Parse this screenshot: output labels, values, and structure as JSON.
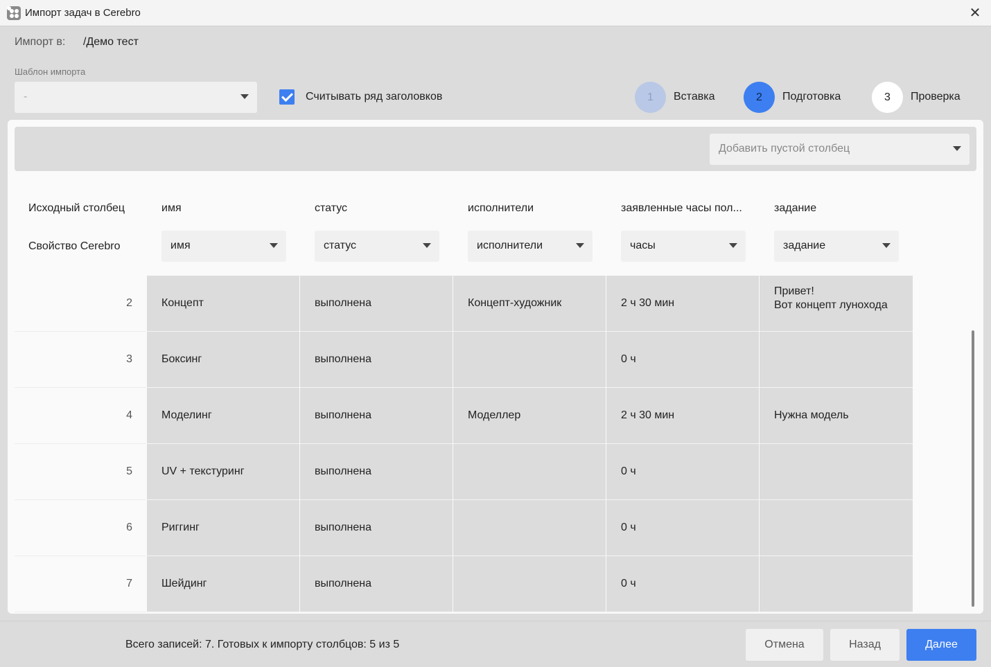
{
  "window": {
    "title": "Импорт задач в Cerebro"
  },
  "import_to": {
    "label": "Импорт в:",
    "value": "/Демо тест"
  },
  "template": {
    "label": "Шаблон импорта",
    "value": "-"
  },
  "header_row_checkbox": {
    "label": "Считывать ряд заголовков",
    "checked": true
  },
  "steps": [
    {
      "number": "1",
      "label": "Вставка"
    },
    {
      "number": "2",
      "label": "Подготовка"
    },
    {
      "number": "3",
      "label": "Проверка"
    }
  ],
  "toolbar": {
    "add_column_placeholder": "Добавить пустой столбец"
  },
  "table": {
    "source_column_label": "Исходный столбец",
    "cerebro_property_label": "Свойство Cerebro",
    "columns": [
      {
        "title": "имя",
        "property": "имя"
      },
      {
        "title": "статус",
        "property": "статус"
      },
      {
        "title": "исполнители",
        "property": "исполнители"
      },
      {
        "title": "заявленные часы пол...",
        "property": "часы"
      },
      {
        "title": "задание",
        "property": "задание"
      }
    ],
    "rows": [
      {
        "num": "2",
        "cells": [
          "Концепт",
          "выполнена",
          "Концепт-художник",
          "2 ч 30 мин",
          "Привет!\nВот концепт лунохода"
        ]
      },
      {
        "num": "3",
        "cells": [
          "Боксинг",
          "выполнена",
          "",
          "0 ч",
          ""
        ]
      },
      {
        "num": "4",
        "cells": [
          "Моделинг",
          "выполнена",
          "Моделлер",
          "2 ч 30 мин",
          "Нужна модель"
        ]
      },
      {
        "num": "5",
        "cells": [
          "UV + текстуринг",
          "выполнена",
          "",
          "0 ч",
          ""
        ]
      },
      {
        "num": "6",
        "cells": [
          "Риггинг",
          "выполнена",
          "",
          "0 ч",
          ""
        ]
      },
      {
        "num": "7",
        "cells": [
          "Шейдинг",
          "выполнена",
          "",
          "0 ч",
          ""
        ]
      }
    ]
  },
  "footer": {
    "summary": "Всего записей: 7. Готовых к импорту столбцов: 5 из 5",
    "cancel_label": "Отмена",
    "back_label": "Назад",
    "next_label": "Далее"
  },
  "icons": {
    "close": "close-icon",
    "dropdown": "chevron-down-icon",
    "app": "app-icon"
  },
  "colors": {
    "accent": "#3d7ff0",
    "step_done": "#b9c8e6",
    "background": "#dcdcdc"
  }
}
